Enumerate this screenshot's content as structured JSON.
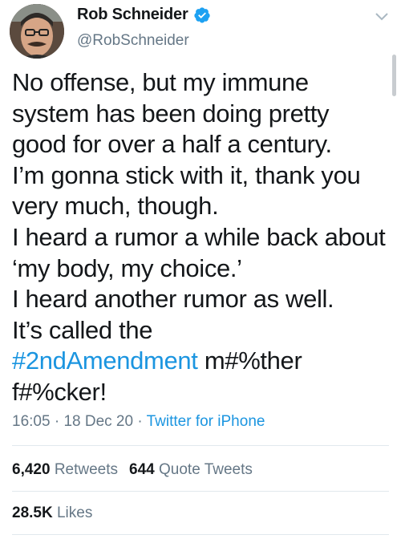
{
  "user": {
    "display_name": "Rob Schneider",
    "handle": "@RobSchneider"
  },
  "tweet": {
    "lines": [
      "No offense, but my immune",
      "system has been doing pretty",
      "good for over a half a century.",
      "I’m gonna stick with it, thank you",
      "very much, though.",
      "I heard a rumor a while back about",
      "‘my body, my choice.’",
      "I heard another rumor as well.",
      "It’s called the"
    ],
    "hashtag": "#2ndAmendment",
    "after_hashtag": " m#%ther",
    "last_line": "f#%cker!"
  },
  "meta": {
    "time": "16:05",
    "sep1": " · ",
    "date": "18 Dec 20",
    "sep2": " · ",
    "source": "Twitter for iPhone"
  },
  "stats": {
    "retweets_count": "6,420",
    "retweets_label": "Retweets",
    "quotes_count": "644",
    "quotes_label": "Quote Tweets",
    "likes_count": "28.5K",
    "likes_label": "Likes"
  },
  "colors": {
    "accent": "#1b95e0",
    "text": "#14171a",
    "secondary": "#657786",
    "divider": "#e1e8ed"
  },
  "icons": [
    "verified-badge-icon",
    "chevron-down-icon"
  ]
}
